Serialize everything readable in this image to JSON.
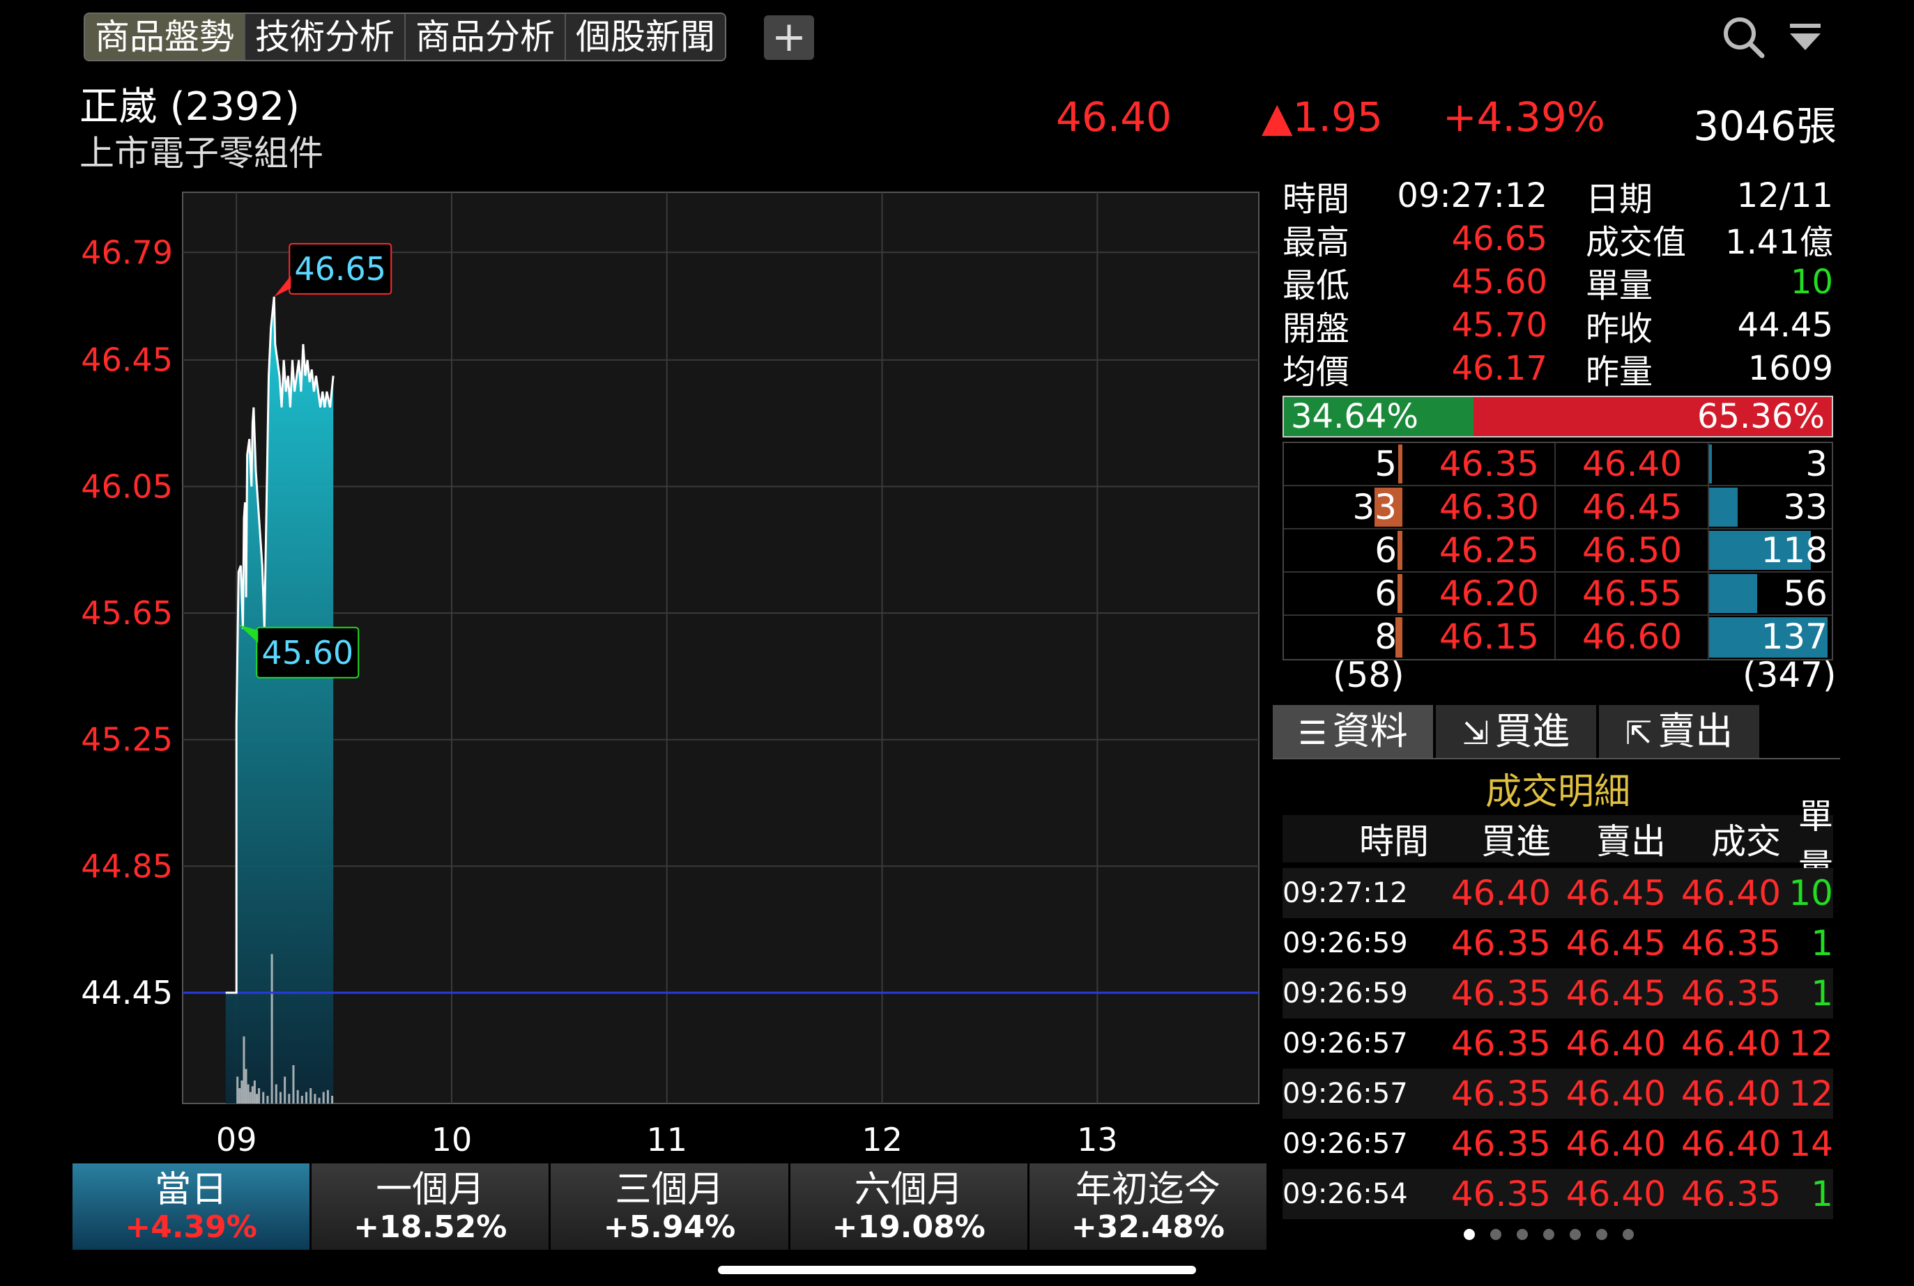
{
  "tabs": [
    {
      "label": "商品盤勢",
      "active": true
    },
    {
      "label": "技術分析",
      "active": false
    },
    {
      "label": "商品分析",
      "active": false
    },
    {
      "label": "個股新聞",
      "active": false
    }
  ],
  "add_tab_label": "+",
  "icons": {
    "search": "search-icon",
    "filter": "filter-icon"
  },
  "stock": {
    "name": "正崴 (2392)",
    "category": "上市電子零組件",
    "price": "46.40",
    "change": "▲1.95",
    "change_pct": "+4.39%",
    "volume": "3046張"
  },
  "info": {
    "rows": [
      {
        "k1": "時間",
        "v1": "09:27:12",
        "v1c": "white",
        "k2": "日期",
        "v2": "12/11",
        "v2c": "white"
      },
      {
        "k1": "最高",
        "v1": "46.65",
        "v1c": "red",
        "k2": "成交值",
        "v2": "1.41億",
        "v2c": "white"
      },
      {
        "k1": "最低",
        "v1": "45.60",
        "v1c": "red",
        "k2": "單量",
        "v2": "10",
        "v2c": "green"
      },
      {
        "k1": "開盤",
        "v1": "45.70",
        "v1c": "red",
        "k2": "昨收",
        "v2": "44.45",
        "v2c": "white"
      },
      {
        "k1": "均價",
        "v1": "46.17",
        "v1c": "red",
        "k2": "昨量",
        "v2": "1609",
        "v2c": "white"
      }
    ]
  },
  "ratio": {
    "buy": "34.64%",
    "sell": "65.36%",
    "buy_fraction": 0.3464
  },
  "book": {
    "rows": [
      {
        "bid_qty": "5",
        "bid": "46.35",
        "ask": "46.40",
        "ask_qty": "3"
      },
      {
        "bid_qty": "33",
        "bid": "46.30",
        "ask": "46.45",
        "ask_qty": "33"
      },
      {
        "bid_qty": "6",
        "bid": "46.25",
        "ask": "46.50",
        "ask_qty": "118"
      },
      {
        "bid_qty": "6",
        "bid": "46.20",
        "ask": "46.55",
        "ask_qty": "56"
      },
      {
        "bid_qty": "8",
        "bid": "46.15",
        "ask": "46.60",
        "ask_qty": "137"
      }
    ],
    "bid_total": "(58)",
    "ask_total": "(347)"
  },
  "sub_tabs": [
    {
      "label": "資料",
      "icon": "list-icon",
      "active": true
    },
    {
      "label": "買進",
      "icon": "buy-icon",
      "active": false
    },
    {
      "label": "賣出",
      "icon": "sell-icon",
      "active": false
    }
  ],
  "detail": {
    "title": "成交明細",
    "headers": [
      "時間",
      "買進",
      "賣出",
      "成交",
      "單量"
    ],
    "rows": [
      {
        "time": "09:27:12",
        "buy": "46.40",
        "sell": "46.45",
        "deal": "46.40",
        "qty": "10",
        "qc": "green"
      },
      {
        "time": "09:26:59",
        "buy": "46.35",
        "sell": "46.45",
        "deal": "46.35",
        "qty": "1",
        "qc": "green"
      },
      {
        "time": "09:26:59",
        "buy": "46.35",
        "sell": "46.45",
        "deal": "46.35",
        "qty": "1",
        "qc": "green"
      },
      {
        "time": "09:26:57",
        "buy": "46.35",
        "sell": "46.40",
        "deal": "46.40",
        "qty": "12",
        "qc": "red"
      },
      {
        "time": "09:26:57",
        "buy": "46.35",
        "sell": "46.40",
        "deal": "46.40",
        "qty": "12",
        "qc": "red"
      },
      {
        "time": "09:26:57",
        "buy": "46.35",
        "sell": "46.40",
        "deal": "46.40",
        "qty": "14",
        "qc": "red"
      },
      {
        "time": "09:26:54",
        "buy": "46.35",
        "sell": "46.40",
        "deal": "46.35",
        "qty": "1",
        "qc": "green"
      }
    ]
  },
  "page_dots": {
    "count": 7,
    "active": 0
  },
  "periods": [
    {
      "label": "當日",
      "value": "+4.39%",
      "active": true
    },
    {
      "label": "一個月",
      "value": "+18.52%",
      "active": false
    },
    {
      "label": "三個月",
      "value": "+5.94%",
      "active": false
    },
    {
      "label": "六個月",
      "value": "+19.08%",
      "active": false
    },
    {
      "label": "年初迄今",
      "value": "+32.48%",
      "active": false
    }
  ],
  "chart_data": {
    "type": "area",
    "x_ticks": [
      "09",
      "10",
      "11",
      "12",
      "13"
    ],
    "y_ticks": [
      "46.79",
      "46.45",
      "46.05",
      "45.65",
      "45.25",
      "44.85",
      "44.45"
    ],
    "ylim": [
      44.1,
      46.98
    ],
    "reference": 44.45,
    "high_label": "46.65",
    "low_label": "45.60",
    "series": [
      {
        "values": [
          [
            8.95,
            44.45
          ],
          [
            9.0,
            44.45
          ],
          [
            9.0,
            45.3
          ],
          [
            9.01,
            45.78
          ],
          [
            9.02,
            45.8
          ],
          [
            9.03,
            45.6
          ],
          [
            9.035,
            45.95
          ],
          [
            9.04,
            46.0
          ],
          [
            9.045,
            45.7
          ],
          [
            9.05,
            46.15
          ],
          [
            9.06,
            46.2
          ],
          [
            9.07,
            46.05
          ],
          [
            9.075,
            46.25
          ],
          [
            9.08,
            46.3
          ],
          [
            9.09,
            46.1
          ],
          [
            9.1,
            46.0
          ],
          [
            9.11,
            45.9
          ],
          [
            9.12,
            45.8
          ],
          [
            9.13,
            45.6
          ],
          [
            9.14,
            46.0
          ],
          [
            9.15,
            46.4
          ],
          [
            9.16,
            46.55
          ],
          [
            9.175,
            46.65
          ],
          [
            9.18,
            46.5
          ],
          [
            9.19,
            46.45
          ],
          [
            9.2,
            46.4
          ],
          [
            9.21,
            46.3
          ],
          [
            9.22,
            46.45
          ],
          [
            9.23,
            46.35
          ],
          [
            9.24,
            46.4
          ],
          [
            9.25,
            46.3
          ],
          [
            9.26,
            46.45
          ],
          [
            9.27,
            46.35
          ],
          [
            9.28,
            46.4
          ],
          [
            9.29,
            46.45
          ],
          [
            9.3,
            46.35
          ],
          [
            9.31,
            46.5
          ],
          [
            9.32,
            46.4
          ],
          [
            9.33,
            46.45
          ],
          [
            9.34,
            46.38
          ],
          [
            9.35,
            46.42
          ],
          [
            9.36,
            46.35
          ],
          [
            9.37,
            46.4
          ],
          [
            9.38,
            46.35
          ],
          [
            9.39,
            46.3
          ],
          [
            9.4,
            46.35
          ],
          [
            9.41,
            46.3
          ],
          [
            9.42,
            46.35
          ],
          [
            9.435,
            46.3
          ],
          [
            9.45,
            46.4
          ]
        ]
      }
    ],
    "volume_bars": [
      [
        9.0,
        14
      ],
      [
        9.01,
        8
      ],
      [
        9.02,
        12
      ],
      [
        9.03,
        35
      ],
      [
        9.04,
        18
      ],
      [
        9.05,
        10
      ],
      [
        9.06,
        6
      ],
      [
        9.07,
        9
      ],
      [
        9.08,
        12
      ],
      [
        9.09,
        5
      ],
      [
        9.1,
        8
      ],
      [
        9.12,
        6
      ],
      [
        9.14,
        4
      ],
      [
        9.16,
        78
      ],
      [
        9.18,
        10
      ],
      [
        9.2,
        6
      ],
      [
        9.22,
        14
      ],
      [
        9.24,
        5
      ],
      [
        9.26,
        20
      ],
      [
        9.28,
        7
      ],
      [
        9.3,
        4
      ],
      [
        9.32,
        6
      ],
      [
        9.34,
        8
      ],
      [
        9.36,
        5
      ],
      [
        9.38,
        3
      ],
      [
        9.4,
        6
      ],
      [
        9.42,
        7
      ],
      [
        9.44,
        4
      ]
    ],
    "volume_max": 80,
    "colors": {
      "line": "#ffffff",
      "fill_top": "#1ec8d8",
      "fill_bottom": "#0a2a3a",
      "reference": "#2a3adf",
      "axis_text": "#ff2b2b"
    }
  }
}
